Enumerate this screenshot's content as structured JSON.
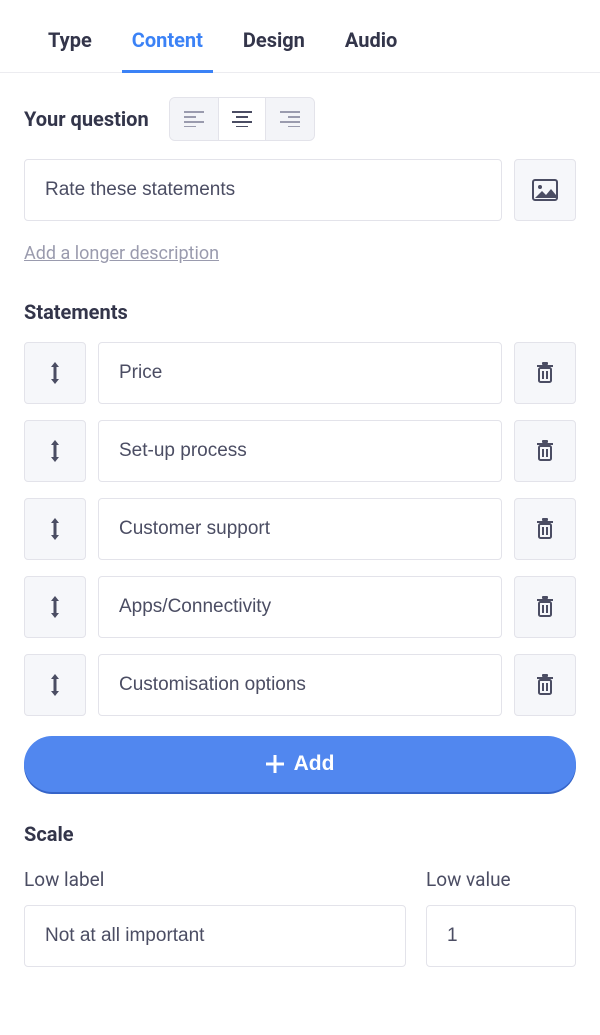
{
  "tabs": {
    "type": "Type",
    "content": "Content",
    "design": "Design",
    "audio": "Audio",
    "active": "content"
  },
  "question": {
    "label": "Your question",
    "value": "Rate these statements",
    "description_link": "Add a longer description"
  },
  "statements": {
    "heading": "Statements",
    "items": [
      {
        "value": "Price"
      },
      {
        "value": "Set-up process"
      },
      {
        "value": "Customer support"
      },
      {
        "value": "Apps/Connectivity"
      },
      {
        "value": "Customisation options"
      }
    ],
    "add_label": "Add"
  },
  "scale": {
    "heading": "Scale",
    "low_label_title": "Low label",
    "low_label_value": "Not at all important",
    "low_value_title": "Low value",
    "low_value_value": "1"
  }
}
